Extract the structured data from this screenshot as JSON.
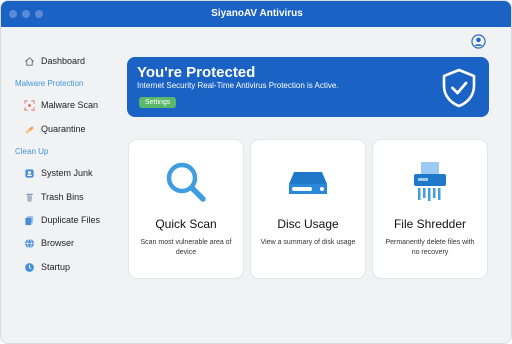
{
  "window": {
    "title": "SiyanoAV Antivirus"
  },
  "sidebar": {
    "dashboard": "Dashboard",
    "section_malware": "Malware Protection",
    "malware_scan": "Malware Scan",
    "quarantine": "Quarantine",
    "section_cleanup": "Clean Up",
    "system_junk": "System Junk",
    "trash_bins": "Trash Bins",
    "duplicate_files": "Duplicate Files",
    "browser": "Browser",
    "startup": "Startup"
  },
  "banner": {
    "title": "You're Protected",
    "status": "Internet Security Real-Time Antivirus Protection is Active.",
    "settings_label": "Settings"
  },
  "cards": {
    "quick_scan": {
      "title": "Quick Scan",
      "desc": "Scan most vulnerable area of device"
    },
    "disc_usage": {
      "title": "Disc Usage",
      "desc": "View a summary of disk usage"
    },
    "file_shredder": {
      "title": "File Shredder",
      "desc": "Permanently delete files with no recovery"
    }
  },
  "colors": {
    "brand": "#1a62c4",
    "accent": "#3f97d9",
    "success": "#5bb86a"
  }
}
